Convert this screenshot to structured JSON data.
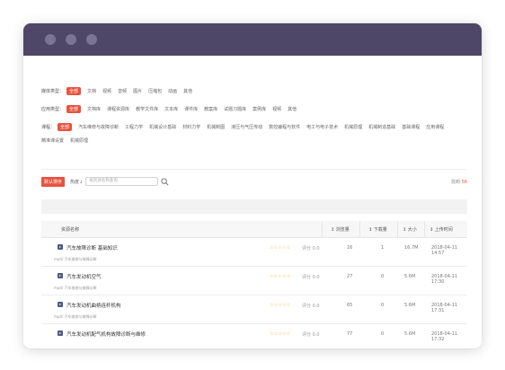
{
  "filters": {
    "media": {
      "label": "媒体类型：",
      "items": [
        "全部",
        "文档",
        "视频",
        "音频",
        "图片",
        "压缩包",
        "动画",
        "其他"
      ],
      "active": 0
    },
    "usage": {
      "label": "应用类型：",
      "items": [
        "全部",
        "文档库",
        "课程资源库",
        "教学文件库",
        "文本库",
        "课件库",
        "教案库",
        "试题习题库",
        "案例库",
        "视频",
        "其他"
      ],
      "active": 0
    },
    "course": {
      "label": "课程：",
      "items": [
        "全部",
        "汽车维修与故障诊断",
        "工程力学",
        "机械设计基础",
        "材料力学",
        "机械制图",
        "液压与气压传动",
        "数控编程与软件",
        "电工与电子技术",
        "机械原理",
        "机械制造基础",
        "基础课程",
        "应用课程",
        "精准课设置",
        "机械原理"
      ],
      "active": 0
    }
  },
  "toolbar": {
    "sort_default": "默认排序",
    "sort_heat": "热度↓",
    "search_placeholder": "按资源名称查询",
    "found_prefix": "找到",
    "found_count": "56"
  },
  "table": {
    "headers": {
      "name": "资源名称",
      "views": "↕ 浏览量",
      "downloads": "↕ 下载量",
      "size": "↕ 大小",
      "time": "↕ 上传时间"
    },
    "rows": [
      {
        "title": "汽车故障诊断 基础知识",
        "meta": "mp4/ 汽车维修与故障诊断",
        "stars": "☆☆☆☆☆",
        "score": "评分 0.0",
        "views": "16",
        "downloads": "1",
        "size": "16.7M",
        "time": "2018-04-11 14:57"
      },
      {
        "title": "汽车发动机空气",
        "meta": "mp4/ 汽车维修与故障诊断",
        "stars": "☆☆☆☆☆",
        "score": "评分 0.0",
        "views": "27",
        "downloads": "0",
        "size": "5.6M",
        "time": "2018-04-11 17:30"
      },
      {
        "title": "汽车发动机曲柄连杆机构",
        "meta": "mp4/ 汽车维修与故障诊断",
        "stars": "☆☆☆☆☆",
        "score": "评分 0.0",
        "views": "65",
        "downloads": "0",
        "size": "5.6M",
        "time": "2018-04-11 17:31"
      },
      {
        "title": "汽车发动机配气机构故障诊断与维修",
        "meta": "",
        "stars": "☆☆☆☆☆",
        "score": "评分 0.0",
        "views": "77",
        "downloads": "0",
        "size": "5.6M",
        "time": "2018-04-11 17:32"
      }
    ]
  },
  "colors": {
    "accent": "#e8533f",
    "titlebar": "#4f4767",
    "window_dot": "#7b7494",
    "star": "#f5a623"
  }
}
